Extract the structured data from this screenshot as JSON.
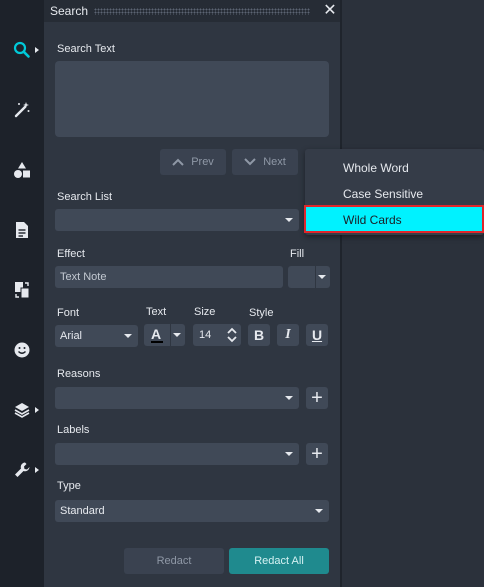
{
  "rail": {
    "items": [
      {
        "icon": "search-icon",
        "active": true,
        "has_submenu": true
      },
      {
        "icon": "magic-wand-icon",
        "has_submenu": false
      },
      {
        "icon": "shapes-icon",
        "has_submenu": false
      },
      {
        "icon": "document-icon",
        "has_submenu": false
      },
      {
        "icon": "page-swap-icon",
        "has_submenu": false
      },
      {
        "icon": "emoji-icon",
        "has_submenu": false
      },
      {
        "icon": "layers-icon",
        "has_submenu": true
      },
      {
        "icon": "wrench-icon",
        "has_submenu": true
      }
    ]
  },
  "panel": {
    "title": "Search",
    "close_glyph": "✕",
    "search_text_label": "Search Text",
    "search_text_value": "",
    "prev_label": "Prev",
    "next_label": "Next",
    "search_list_label": "Search List",
    "search_list_value": "",
    "effect_label": "Effect",
    "effect_value": "Text Note",
    "fill_label": "Fill",
    "font_label": "Font",
    "font_value": "Arial",
    "text_label": "Text",
    "text_glyph": "A",
    "size_label": "Size",
    "size_value": "14",
    "style_label": "Style",
    "bold_glyph": "B",
    "italic_glyph": "I",
    "underline_glyph": "U",
    "reasons_label": "Reasons",
    "reasons_value": "",
    "labels_label": "Labels",
    "labels_value": "",
    "plus_glyph": "+",
    "type_label": "Type",
    "type_value": "Standard",
    "redact_label": "Redact",
    "redact_all_label": "Redact All"
  },
  "options_menu": {
    "items": [
      {
        "label": "Whole Word"
      },
      {
        "label": "Case Sensitive"
      },
      {
        "label": "Wild Cards",
        "highlighted": true
      }
    ]
  },
  "colors": {
    "accent": "#00f2ff",
    "redact_all_bg": "#1f8a8e",
    "highlight_border": "#e0262b",
    "panel_bg": "#2f3641",
    "rail_bg": "#1d222a"
  }
}
